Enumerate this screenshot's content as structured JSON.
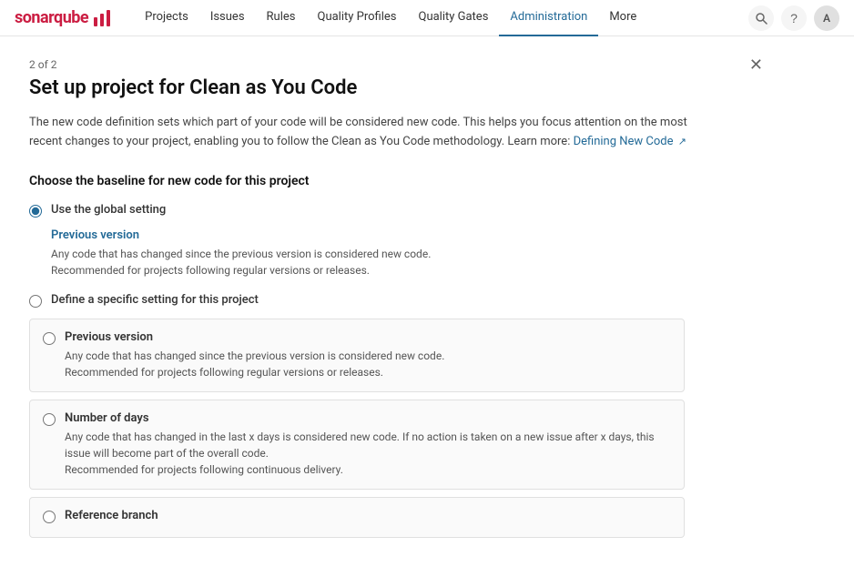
{
  "navbar": {
    "logo": "sonarqube",
    "items": [
      {
        "label": "Projects",
        "active": false
      },
      {
        "label": "Issues",
        "active": false
      },
      {
        "label": "Rules",
        "active": false
      },
      {
        "label": "Quality Profiles",
        "active": false
      },
      {
        "label": "Quality Gates",
        "active": false
      },
      {
        "label": "Administration",
        "active": true
      },
      {
        "label": "More",
        "active": false
      }
    ],
    "help_icon": "?",
    "avatar_label": "A"
  },
  "dialog": {
    "step": "2 of 2",
    "title": "Set up project for Clean as You Code",
    "description_part1": "The new code definition sets which part of your code will be considered new code. This helps you focus attention on the most recent changes to your project, enabling you to follow the Clean as You Code methodology. Learn more:",
    "description_link": "Defining New Code",
    "section_title": "Choose the baseline for new code for this project",
    "global_setting_label": "Use the global setting",
    "global_sub_heading": "Previous version",
    "global_sub_text1": "Any code that has changed since the previous version is considered new code.",
    "global_sub_text2": "Recommended for projects following regular versions or releases.",
    "specific_setting_label": "Define a specific setting for this project",
    "specific_options": [
      {
        "id": "prev-version",
        "title": "Previous version",
        "desc1": "Any code that has changed since the previous version is considered new code.",
        "desc2": "Recommended for projects following regular versions or releases."
      },
      {
        "id": "num-days",
        "title": "Number of days",
        "desc1": "Any code that has changed in the last x days is considered new code. If no action is taken on a new issue after x days, this issue will become part of the overall code.",
        "desc2": "Recommended for projects following continuous delivery."
      },
      {
        "id": "ref-branch",
        "title": "Reference branch",
        "desc1": "",
        "desc2": ""
      }
    ]
  }
}
